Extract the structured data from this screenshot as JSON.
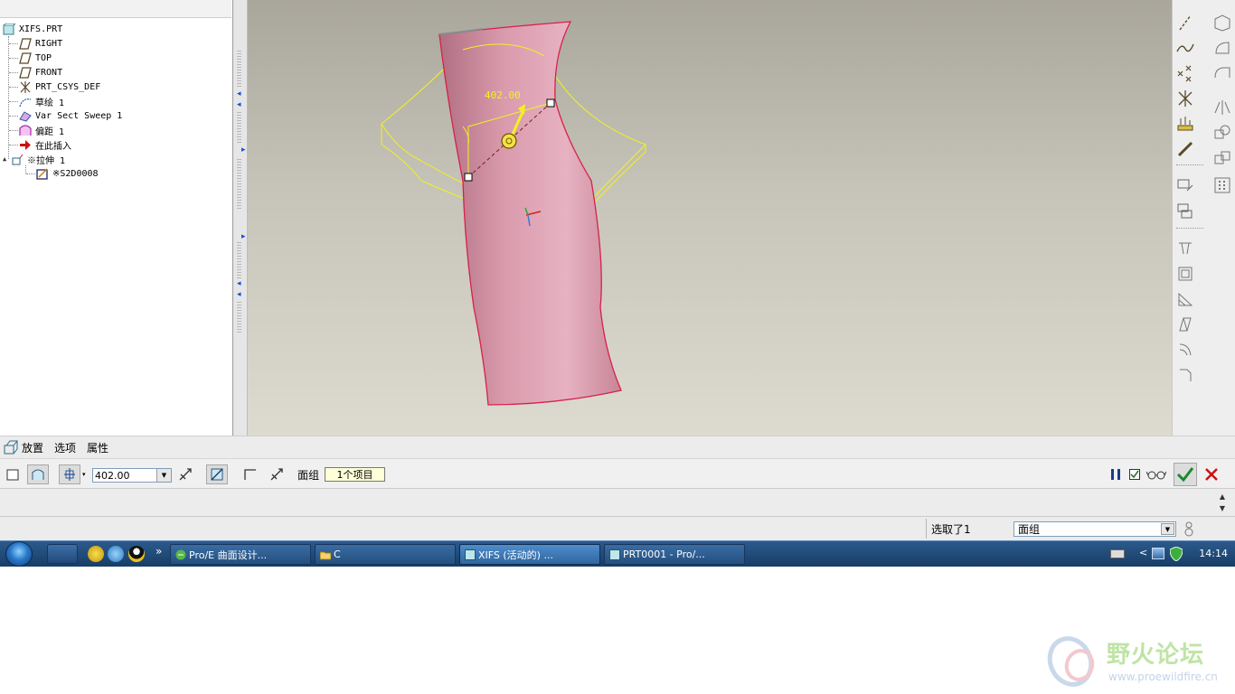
{
  "model_tree": {
    "nodes": [
      {
        "label": "XIFS.PRT",
        "icon": "part-icon"
      },
      {
        "label": "RIGHT",
        "icon": "datum-plane-icon"
      },
      {
        "label": "TOP",
        "icon": "datum-plane-icon"
      },
      {
        "label": "FRONT",
        "icon": "datum-plane-icon"
      },
      {
        "label": "PRT_CSYS_DEF",
        "icon": "coordinate-system-icon"
      },
      {
        "label": "草绘 1",
        "icon": "sketch-icon"
      },
      {
        "label": "Var Sect Sweep 1",
        "icon": "sweep-icon"
      },
      {
        "label": "偏距 1",
        "icon": "offset-icon"
      },
      {
        "label": "在此插入",
        "icon": "insert-here-arrow-icon"
      },
      {
        "label": "※拉伸 1",
        "icon": "extrude-icon"
      },
      {
        "label": "※S2D0008",
        "icon": "section-sketch-icon"
      }
    ]
  },
  "viewport": {
    "dimension_value": "402.00",
    "surface_color": "#e3aab9",
    "edge_color": "#d8204a",
    "preview_color": "#f0f020"
  },
  "dashboard": {
    "tabs": [
      "放置",
      "选项",
      "属性"
    ],
    "depth_value": "402.00",
    "quilt_label": "面组",
    "quilt_collector": "1个项目"
  },
  "status_bar": {
    "selection_count": "选取了1",
    "filter_value": "面组"
  },
  "taskbar": {
    "tasks": [
      {
        "label": "Pro/E 曲面设计...",
        "icon": "ie-icon"
      },
      {
        "label": "C",
        "icon": "folder-icon"
      },
      {
        "label": "XIFS (活动的) ...",
        "icon": "proe-window-icon"
      },
      {
        "label": "PRT0001 - Pro/...",
        "icon": "proe-window-icon"
      }
    ],
    "overflow_glyph": "»",
    "clock": "14:14"
  },
  "watermark": {
    "title": "野火论坛",
    "url": "www.proewildfire.cn"
  }
}
